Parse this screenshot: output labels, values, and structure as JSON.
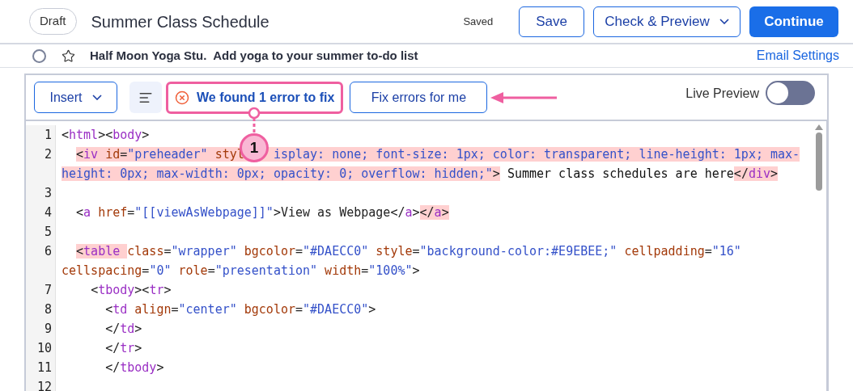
{
  "header": {
    "status": "Draft",
    "title": "Summer Class Schedule",
    "save_state": "Saved",
    "buttons": [
      {
        "label": "Save",
        "kind": "outline"
      },
      {
        "label": "Check & Preview",
        "kind": "dropdown"
      },
      {
        "label": "Continue",
        "kind": "primary"
      }
    ]
  },
  "subject_row": {
    "checked": false,
    "starred": false,
    "text": "Half Moon Yoga Stu.  Add yoga to your summer to-do list",
    "link": "Email Settings"
  },
  "toolbar": {
    "insert": "Insert",
    "error_message": "We found 1 error to fix",
    "fix_button": "Fix errors for me",
    "live_preview": {
      "label": "Live Preview",
      "on": false
    }
  },
  "callout": {
    "number": "1"
  },
  "code_lines": [
    {
      "number": "1",
      "segments": [
        {
          "error": false,
          "tokens": [
            {
              "text": "<",
              "kind": "punct"
            },
            {
              "text": "html",
              "kind": "tag"
            },
            {
              "text": "><",
              "kind": "punct"
            },
            {
              "text": "body",
              "kind": "tag"
            },
            {
              "text": ">",
              "kind": "punct"
            }
          ]
        }
      ]
    },
    {
      "number": "2",
      "segments": [
        {
          "error": true,
          "tokens": [
            {
              "text": "  <",
              "kind": "punct"
            },
            {
              "text": "iv",
              "kind": "tag"
            },
            {
              "text": " id",
              "kind": "attr"
            },
            {
              "text": "=",
              "kind": "punct"
            },
            {
              "text": "\"preheader\"",
              "kind": "str"
            },
            {
              "text": " styl",
              "kind": "attr"
            },
            {
              "kind": "covered"
            },
            {
              "text": "isplay: none; font-size: 1px; color: transparent; line-height: 1px; max-",
              "kind": "str"
            },
            {
              "kind": "wrap"
            },
            {
              "text": "height: 0px; max-width: 0px; opacity: 0; overflow: hidden;\"",
              "kind": "str"
            },
            {
              "text": ">",
              "kind": "punct"
            }
          ]
        },
        {
          "error": false,
          "tokens": [
            {
              "text": " Summer class schedules are here",
              "kind": "text"
            }
          ]
        },
        {
          "error": true,
          "tokens": [
            {
              "text": "</",
              "kind": "punct"
            },
            {
              "text": "div",
              "kind": "tag"
            },
            {
              "text": ">",
              "kind": "punct"
            }
          ]
        }
      ]
    },
    {
      "number": "3"
    },
    {
      "number": "4",
      "segments": [
        {
          "error": false,
          "tokens": [
            {
              "text": "  <",
              "kind": "punct"
            },
            {
              "text": "a",
              "kind": "tag"
            },
            {
              "text": " href",
              "kind": "attr"
            },
            {
              "text": "=",
              "kind": "punct"
            },
            {
              "text": "\"[[viewAsWebpage]]\"",
              "kind": "str"
            },
            {
              "text": ">View as Webpage</",
              "kind": "punct"
            },
            {
              "text": "a",
              "kind": "tag"
            },
            {
              "text": ">",
              "kind": "punct"
            }
          ]
        },
        {
          "error": true,
          "tokens": [
            {
              "text": "</",
              "kind": "punct"
            },
            {
              "text": "a",
              "kind": "tag"
            },
            {
              "text": ">",
              "kind": "punct"
            }
          ]
        }
      ]
    },
    {
      "number": "5"
    },
    {
      "number": "6",
      "segments": [
        {
          "error": true,
          "tokens": [
            {
              "text": "  <",
              "kind": "punct"
            },
            {
              "text": "table ",
              "kind": "tag"
            }
          ]
        },
        {
          "error": false,
          "tokens": [
            {
              "text": "class",
              "kind": "attr"
            },
            {
              "text": "=",
              "kind": "punct"
            },
            {
              "text": "\"wrapper\"",
              "kind": "str"
            },
            {
              "text": " bgcolor",
              "kind": "attr"
            },
            {
              "text": "=",
              "kind": "punct"
            },
            {
              "text": "\"#DAECC0\"",
              "kind": "str"
            },
            {
              "text": " style",
              "kind": "attr"
            },
            {
              "text": "=",
              "kind": "punct"
            },
            {
              "text": "\"background-color:#E9EBEE;\"",
              "kind": "str"
            },
            {
              "text": " cellpadding",
              "kind": "attr"
            },
            {
              "text": "=",
              "kind": "punct"
            },
            {
              "text": "\"16\"",
              "kind": "str"
            },
            {
              "kind": "wrap"
            },
            {
              "text": "cellspacing",
              "kind": "attr"
            },
            {
              "text": "=",
              "kind": "punct"
            },
            {
              "text": "\"0\"",
              "kind": "str"
            },
            {
              "text": " role",
              "kind": "attr"
            },
            {
              "text": "=",
              "kind": "punct"
            },
            {
              "text": "\"presentation\"",
              "kind": "str"
            },
            {
              "text": " width",
              "kind": "attr"
            },
            {
              "text": "=",
              "kind": "punct"
            },
            {
              "text": "\"100%\"",
              "kind": "str"
            },
            {
              "text": ">",
              "kind": "punct"
            }
          ]
        }
      ]
    },
    {
      "number": "7",
      "segments": [
        {
          "error": false,
          "tokens": [
            {
              "text": "    <",
              "kind": "punct"
            },
            {
              "text": "tbody",
              "kind": "tag"
            },
            {
              "text": "><",
              "kind": "punct"
            },
            {
              "text": "tr",
              "kind": "tag"
            },
            {
              "text": ">",
              "kind": "punct"
            }
          ]
        }
      ]
    },
    {
      "number": "8",
      "segments": [
        {
          "error": false,
          "tokens": [
            {
              "text": "      <",
              "kind": "punct"
            },
            {
              "text": "td",
              "kind": "tag"
            },
            {
              "text": " align",
              "kind": "attr"
            },
            {
              "text": "=",
              "kind": "punct"
            },
            {
              "text": "\"center\"",
              "kind": "str"
            },
            {
              "text": " bgcolor",
              "kind": "attr"
            },
            {
              "text": "=",
              "kind": "punct"
            },
            {
              "text": "\"#DAECC0\"",
              "kind": "str"
            },
            {
              "text": ">",
              "kind": "punct"
            }
          ]
        }
      ]
    },
    {
      "number": "9",
      "segments": [
        {
          "error": false,
          "tokens": [
            {
              "text": "      </",
              "kind": "punct"
            },
            {
              "text": "td",
              "kind": "tag"
            },
            {
              "text": ">",
              "kind": "punct"
            }
          ]
        }
      ]
    },
    {
      "number": "10",
      "segments": [
        {
          "error": false,
          "tokens": [
            {
              "text": "      </",
              "kind": "punct"
            },
            {
              "text": "tr",
              "kind": "tag"
            },
            {
              "text": ">",
              "kind": "punct"
            }
          ]
        }
      ]
    },
    {
      "number": "11",
      "segments": [
        {
          "error": false,
          "tokens": [
            {
              "text": "      </",
              "kind": "punct"
            },
            {
              "text": "tbody",
              "kind": "tag"
            },
            {
              "text": ">",
              "kind": "punct"
            }
          ]
        }
      ]
    },
    {
      "number": "12"
    }
  ]
}
